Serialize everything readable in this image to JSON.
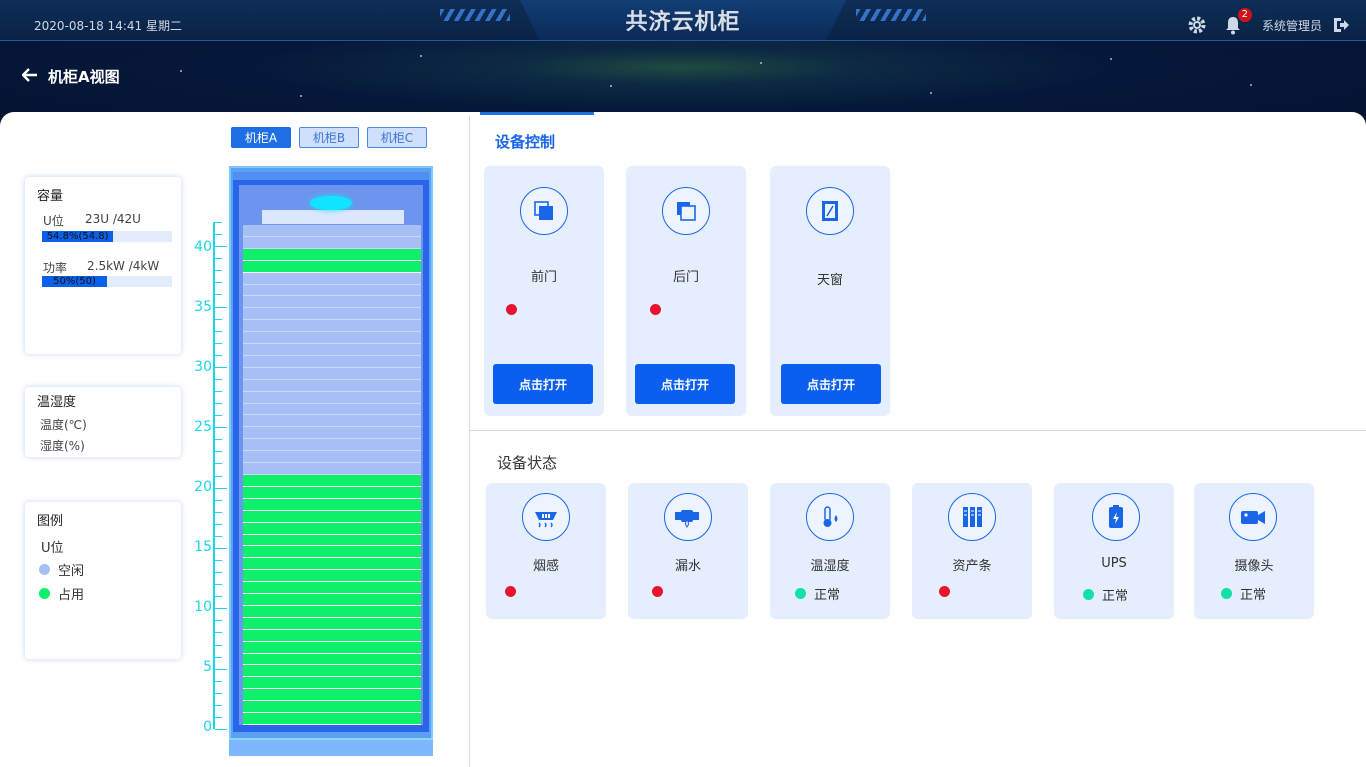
{
  "header": {
    "datetime": "2020-08-18 14:41 星期二",
    "title": "共济云机柜",
    "notification_count": "2",
    "user": "系统管理员"
  },
  "page": {
    "back_title": "机柜A视图"
  },
  "cabinet_tabs": [
    {
      "label": "机柜A",
      "active": true
    },
    {
      "label": "机柜B",
      "active": false
    },
    {
      "label": "机柜C",
      "active": false
    }
  ],
  "capacity": {
    "title": "容量",
    "u_label": "U位",
    "u_value": "23U /42U",
    "u_percent_text": "54.8%(54.8)",
    "u_fraction": 0.548,
    "power_label": "功率",
    "power_value": "2.5kW /4kW",
    "power_percent_text": "50%(50)",
    "power_fraction": 0.5
  },
  "env": {
    "title": "温湿度",
    "temp_label": "温度(℃)",
    "humidity_label": "湿度(%)"
  },
  "legend": {
    "title": "图例",
    "subtitle": "U位",
    "items": [
      {
        "label": "空闲",
        "color": "#a6c0f5"
      },
      {
        "label": "占用",
        "color": "#0ff06a"
      }
    ]
  },
  "rack": {
    "scale_labels": [
      "40",
      "35",
      "30",
      "25",
      "20",
      "15",
      "10",
      "5",
      "0"
    ],
    "total_u": 42,
    "occupied_u": [
      1,
      2,
      3,
      4,
      5,
      6,
      7,
      8,
      9,
      10,
      11,
      12,
      13,
      14,
      15,
      16,
      17,
      18,
      19,
      20,
      21,
      39,
      40
    ],
    "colors": {
      "free": "#a6c0f5",
      "used": "#0ff06a",
      "frame": "#2a64e8",
      "scale": "#19d6e8"
    }
  },
  "device_control": {
    "title": "设备控制",
    "items": [
      {
        "name": "前门",
        "icon": "front-door-icon",
        "status": "red",
        "button": "点击打开"
      },
      {
        "name": "后门",
        "icon": "back-door-icon",
        "status": "red",
        "button": "点击打开"
      },
      {
        "name": "天窗",
        "icon": "skylight-icon",
        "status": "",
        "button": "点击打开"
      }
    ]
  },
  "device_status": {
    "title": "设备状态",
    "items": [
      {
        "name": "烟感",
        "icon": "smoke-detector-icon",
        "status_color": "#e8132f",
        "status_text": ""
      },
      {
        "name": "漏水",
        "icon": "water-leak-icon",
        "status_color": "#e8132f",
        "status_text": ""
      },
      {
        "name": "温湿度",
        "icon": "thermometer-icon",
        "status_color": "#12e0a8",
        "status_text": "正常"
      },
      {
        "name": "资产条",
        "icon": "asset-strip-icon",
        "status_color": "#e8132f",
        "status_text": ""
      },
      {
        "name": "UPS",
        "icon": "ups-battery-icon",
        "status_color": "#12e0a8",
        "status_text": "正常"
      },
      {
        "name": "摄像头",
        "icon": "camera-icon",
        "status_color": "#12e0a8",
        "status_text": "正常"
      }
    ]
  }
}
